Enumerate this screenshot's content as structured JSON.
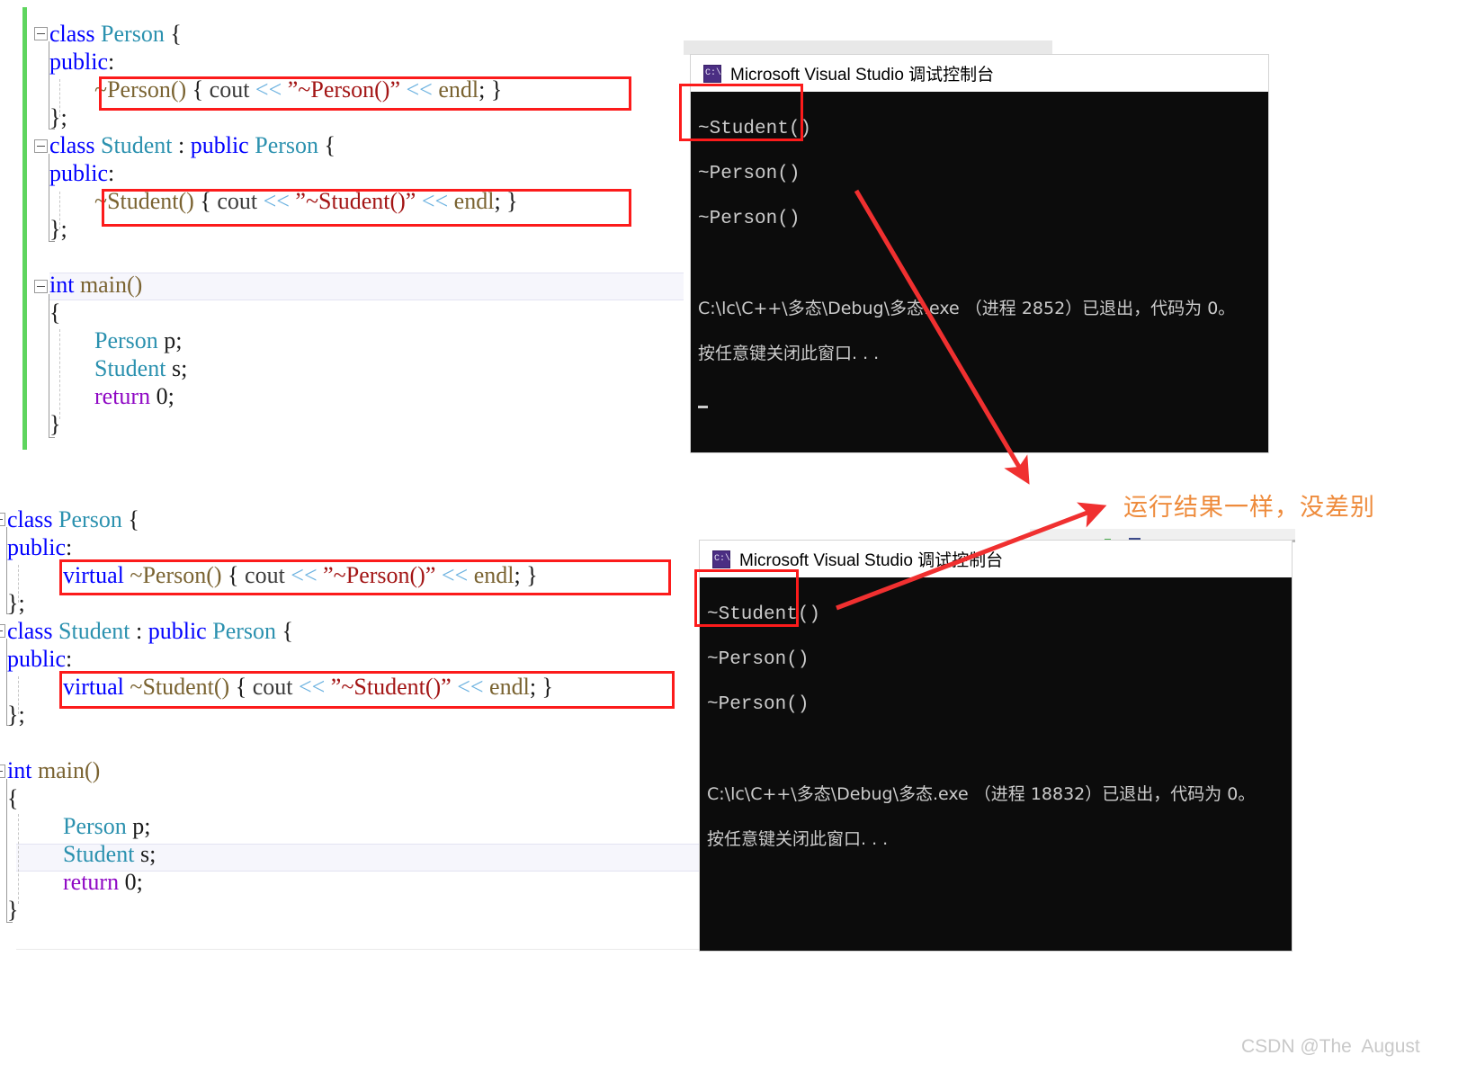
{
  "meta": {
    "watermark": "CSDN @The  August"
  },
  "annotation": {
    "note": "运行结果一样，没差别",
    "note_color": "#ee8b3c",
    "highlight_color": "#fc1b1b",
    "arrow_color": "#f03030"
  },
  "code_block_1": {
    "lines": [
      {
        "indent": 0,
        "tokens": [
          {
            "t": "class ",
            "c": "kw"
          },
          {
            "t": "Person",
            "c": "type"
          },
          {
            "t": " {",
            "c": "plain"
          }
        ]
      },
      {
        "indent": 0,
        "tokens": [
          {
            "t": "public",
            "c": "kw"
          },
          {
            "t": ":",
            "c": "plain"
          }
        ]
      },
      {
        "indent": 1,
        "tokens": [
          {
            "t": "~Person()",
            "c": "fn"
          },
          {
            "t": " { ",
            "c": "plain"
          },
          {
            "t": "cout",
            "c": "obj"
          },
          {
            "t": " ",
            "c": "plain"
          },
          {
            "t": "<<",
            "c": "op"
          },
          {
            "t": " ",
            "c": "plain"
          },
          {
            "t": "”~Person()”",
            "c": "str"
          },
          {
            "t": " ",
            "c": "plain"
          },
          {
            "t": "<<",
            "c": "op"
          },
          {
            "t": " ",
            "c": "plain"
          },
          {
            "t": "endl",
            "c": "fn"
          },
          {
            "t": "; }",
            "c": "plain"
          }
        ]
      },
      {
        "indent": 0,
        "tokens": [
          {
            "t": "};",
            "c": "plain"
          }
        ]
      },
      {
        "indent": 0,
        "tokens": [
          {
            "t": "class ",
            "c": "kw"
          },
          {
            "t": "Student",
            "c": "type"
          },
          {
            "t": " : ",
            "c": "plain"
          },
          {
            "t": "public",
            "c": "kw"
          },
          {
            "t": " ",
            "c": "plain"
          },
          {
            "t": "Person",
            "c": "type"
          },
          {
            "t": " {",
            "c": "plain"
          }
        ]
      },
      {
        "indent": 0,
        "tokens": [
          {
            "t": "public",
            "c": "kw"
          },
          {
            "t": ":",
            "c": "plain"
          }
        ]
      },
      {
        "indent": 1,
        "tokens": [
          {
            "t": "~Student()",
            "c": "fn"
          },
          {
            "t": " { ",
            "c": "plain"
          },
          {
            "t": "cout",
            "c": "obj"
          },
          {
            "t": " ",
            "c": "plain"
          },
          {
            "t": "<<",
            "c": "op"
          },
          {
            "t": " ",
            "c": "plain"
          },
          {
            "t": "”~Student()”",
            "c": "str"
          },
          {
            "t": " ",
            "c": "plain"
          },
          {
            "t": "<<",
            "c": "op"
          },
          {
            "t": " ",
            "c": "plain"
          },
          {
            "t": "endl",
            "c": "fn"
          },
          {
            "t": "; }",
            "c": "plain"
          }
        ]
      },
      {
        "indent": 0,
        "tokens": [
          {
            "t": "};",
            "c": "plain"
          }
        ]
      },
      {
        "indent": 0,
        "tokens": [
          {
            "t": "",
            "c": "plain"
          }
        ]
      },
      {
        "indent": 0,
        "tokens": [
          {
            "t": "int ",
            "c": "kw"
          },
          {
            "t": "main()",
            "c": "fn"
          }
        ]
      },
      {
        "indent": 0,
        "tokens": [
          {
            "t": "{",
            "c": "plain"
          }
        ]
      },
      {
        "indent": 1,
        "tokens": [
          {
            "t": "Person",
            "c": "type"
          },
          {
            "t": " p;",
            "c": "plain"
          }
        ]
      },
      {
        "indent": 1,
        "tokens": [
          {
            "t": "Student",
            "c": "type"
          },
          {
            "t": " s;",
            "c": "plain"
          }
        ]
      },
      {
        "indent": 1,
        "tokens": [
          {
            "t": "return",
            "c": "ctrl"
          },
          {
            "t": " 0;",
            "c": "plain"
          }
        ]
      },
      {
        "indent": 0,
        "tokens": [
          {
            "t": "}",
            "c": "plain"
          }
        ]
      }
    ]
  },
  "code_block_2": {
    "lines": [
      {
        "indent": 0,
        "tokens": [
          {
            "t": "class ",
            "c": "kw"
          },
          {
            "t": "Person",
            "c": "type"
          },
          {
            "t": " {",
            "c": "plain"
          }
        ]
      },
      {
        "indent": 0,
        "tokens": [
          {
            "t": "public",
            "c": "kw"
          },
          {
            "t": ":",
            "c": "plain"
          }
        ]
      },
      {
        "indent": 1,
        "tokens": [
          {
            "t": "virtual",
            "c": "kw"
          },
          {
            "t": " ",
            "c": "plain"
          },
          {
            "t": "~Person()",
            "c": "fn"
          },
          {
            "t": " { ",
            "c": "plain"
          },
          {
            "t": "cout",
            "c": "obj"
          },
          {
            "t": " ",
            "c": "plain"
          },
          {
            "t": "<<",
            "c": "op"
          },
          {
            "t": " ",
            "c": "plain"
          },
          {
            "t": "”~Person()”",
            "c": "str"
          },
          {
            "t": " ",
            "c": "plain"
          },
          {
            "t": "<<",
            "c": "op"
          },
          {
            "t": " ",
            "c": "plain"
          },
          {
            "t": "endl",
            "c": "fn"
          },
          {
            "t": "; }",
            "c": "plain"
          }
        ]
      },
      {
        "indent": 0,
        "tokens": [
          {
            "t": "};",
            "c": "plain"
          }
        ]
      },
      {
        "indent": 0,
        "tokens": [
          {
            "t": "class ",
            "c": "kw"
          },
          {
            "t": "Student",
            "c": "type"
          },
          {
            "t": " : ",
            "c": "plain"
          },
          {
            "t": "public",
            "c": "kw"
          },
          {
            "t": " ",
            "c": "plain"
          },
          {
            "t": "Person",
            "c": "type"
          },
          {
            "t": " {",
            "c": "plain"
          }
        ]
      },
      {
        "indent": 0,
        "tokens": [
          {
            "t": "public",
            "c": "kw"
          },
          {
            "t": ":",
            "c": "plain"
          }
        ]
      },
      {
        "indent": 1,
        "tokens": [
          {
            "t": "virtual",
            "c": "kw"
          },
          {
            "t": " ",
            "c": "plain"
          },
          {
            "t": "~Student()",
            "c": "fn"
          },
          {
            "t": " { ",
            "c": "plain"
          },
          {
            "t": "cout",
            "c": "obj"
          },
          {
            "t": " ",
            "c": "plain"
          },
          {
            "t": "<<",
            "c": "op"
          },
          {
            "t": " ",
            "c": "plain"
          },
          {
            "t": "”~Student()”",
            "c": "str"
          },
          {
            "t": " ",
            "c": "plain"
          },
          {
            "t": "<<",
            "c": "op"
          },
          {
            "t": " ",
            "c": "plain"
          },
          {
            "t": "endl",
            "c": "fn"
          },
          {
            "t": "; }",
            "c": "plain"
          }
        ]
      },
      {
        "indent": 0,
        "tokens": [
          {
            "t": "};",
            "c": "plain"
          }
        ]
      },
      {
        "indent": 0,
        "tokens": [
          {
            "t": "",
            "c": "plain"
          }
        ]
      },
      {
        "indent": 0,
        "tokens": [
          {
            "t": "int ",
            "c": "kw"
          },
          {
            "t": "main()",
            "c": "fn"
          }
        ]
      },
      {
        "indent": 0,
        "tokens": [
          {
            "t": "{",
            "c": "plain"
          }
        ]
      },
      {
        "indent": 1,
        "tokens": [
          {
            "t": "Person",
            "c": "type"
          },
          {
            "t": " p;",
            "c": "plain"
          }
        ]
      },
      {
        "indent": 1,
        "tokens": [
          {
            "t": "Student",
            "c": "type"
          },
          {
            "t": " s;",
            "c": "plain"
          }
        ]
      },
      {
        "indent": 1,
        "tokens": [
          {
            "t": "return",
            "c": "ctrl"
          },
          {
            "t": " 0;",
            "c": "plain"
          }
        ]
      },
      {
        "indent": 0,
        "tokens": [
          {
            "t": "}",
            "c": "plain"
          }
        ]
      }
    ]
  },
  "console_1": {
    "title": "Microsoft Visual Studio 调试控制台",
    "icon": "console-app-icon",
    "output_lines": [
      "~Student()",
      "~Person()",
      "~Person()",
      "",
      "C:\\lc\\C++\\多态\\Debug\\多态.exe （进程 2852）已退出，代码为 0。",
      "按任意键关闭此窗口. . ."
    ],
    "process_id": "2852",
    "exit_code": "0"
  },
  "console_2": {
    "title": "Microsoft Visual Studio 调试控制台",
    "icon": "console-app-icon",
    "output_lines": [
      "~Student()",
      "~Person()",
      "~Person()",
      "",
      "C:\\lc\\C++\\多态\\Debug\\多态.exe （进程 18832）已退出，代码为 0。",
      "按任意键关闭此窗口. . ."
    ],
    "process_id": "18832",
    "exit_code": "0"
  }
}
